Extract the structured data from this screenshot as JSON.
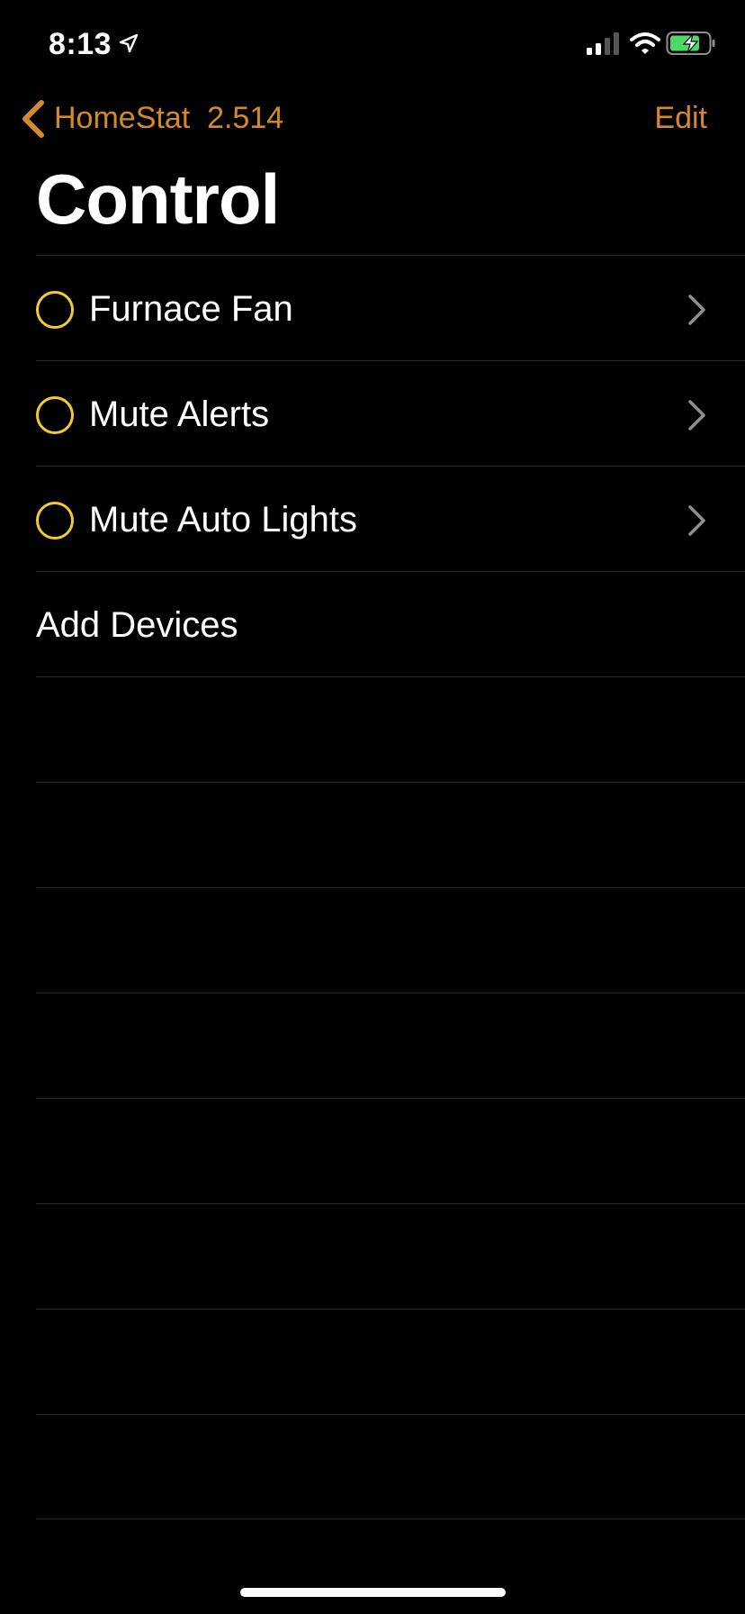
{
  "status_bar": {
    "time": "8:13",
    "icons": [
      "location-arrow-icon",
      "cellular-signal-icon",
      "wifi-icon",
      "battery-charging-icon"
    ]
  },
  "nav": {
    "back_label": "HomeStat  2.514",
    "edit_label": "Edit",
    "accent_color": "#d4892c"
  },
  "page_title": "Control",
  "items": [
    {
      "label": "Furnace Fan",
      "icon": "circle-ring-icon"
    },
    {
      "label": "Mute Alerts",
      "icon": "circle-ring-icon"
    },
    {
      "label": "Mute Auto Lights",
      "icon": "circle-ring-icon"
    }
  ],
  "add_devices_label": "Add Devices",
  "colors": {
    "background": "#000000",
    "ring": "#f2cb2c",
    "separator": "#2a2a2c",
    "chevron": "#8e8e93"
  }
}
